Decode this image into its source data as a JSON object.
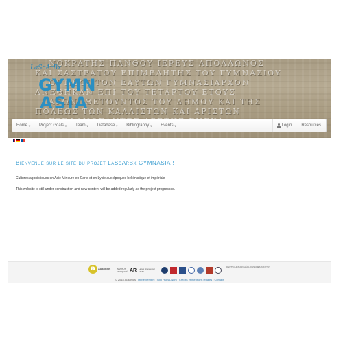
{
  "logo": {
    "small_text": "LaScArBx",
    "line1": "GYMN",
    "line2": "ASIA"
  },
  "banner": {
    "inscription_lines": [
      "ΝΟΚΡΑΤΗΣ ΠΑΝΘΟΥ ΙΕΡΕΥΣ ΑΠΟΛΛΩΝΟΣ",
      "ΚΑΙ ΣΑΣΤΡΑΤΟΥ ΕΠΙΜΕΛΗΤΗΣ ΤΟΥ ΓΥΜΝΑΣΙΟΥ",
      "ΟΙ ΝΕΟΙ ΤΟΝ ΕΑΥΤΩΝ ΓΥΜΝΑΣΙΑΡΧΟΝ",
      "ΑΝΕΘΗΚΑΝ ΕΠΙ ΤΟΥ ΤΕΤΑΡΤΟΥ ΕΤΟΥΣ",
      "ΑΓΩΝΟΘΕΤΟΥΝΤΟΣ ΤΟΥ ΔΗΜΟΥ ΚΑΙ ΤΗΣ",
      "ΠΟΛΕΩΣ ΤΩΝ ΚΑΛΛΙΣΤΩΝ ΚΑΙ ΑΡΙΣΤΩΝ",
      "ΣΤΕΦΑΝΩΣΑΝΤΕΣ ΑΡΕΤΗΣ ΕΝΕΚΑ"
    ]
  },
  "nav": {
    "items": [
      {
        "label": "Home"
      },
      {
        "label": "Project Goals"
      },
      {
        "label": "Team"
      },
      {
        "label": "Database"
      },
      {
        "label": "Bibliography"
      },
      {
        "label": "Events"
      }
    ],
    "caret": "▼",
    "login": "Login",
    "resources": "Resources"
  },
  "flags": [
    {
      "name": "flag-en-icon",
      "colors": [
        "#012169",
        "#ffffff",
        "#c8102e"
      ]
    },
    {
      "name": "flag-de-icon",
      "colors": [
        "#000000",
        "#dd0000",
        "#ffce00"
      ]
    },
    {
      "name": "flag-fr-icon",
      "colors": [
        "#0055a4",
        "#ffffff",
        "#ef4135"
      ]
    }
  ],
  "content": {
    "welcome": "Bienvenue sur le site du projet LaScArBx GYMNASIA !",
    "para1": "Cultures agonistiques en Asie Mineure en Carie et en Lycie aux époques hellénistique et impériale",
    "para2": "This website is still under construction and new content will be added regularly as the project progresses."
  },
  "footer": {
    "ausonius_letter": "a",
    "ausonius_text": "Ausonius",
    "sponsor_text_1": "INSTITUT ANTIQUITÉ",
    "sponsor_text_2": "AR",
    "sponsor_text_3": "Labex financé par l'ANR",
    "dai_text": "DEUTSCHES ARCHÄOLOGISCHES INSTITUT",
    "copyright": "© 2018 Ausonius",
    "hosting": "Hébergement TGIR Huma-Num",
    "credits": "Crédits et mentions légales",
    "contact": "Contact"
  },
  "colors": {
    "accent": "#3a9dd0",
    "logo_blue": "#2b8fc2",
    "ausonius_yellow": "#d7c22a"
  }
}
